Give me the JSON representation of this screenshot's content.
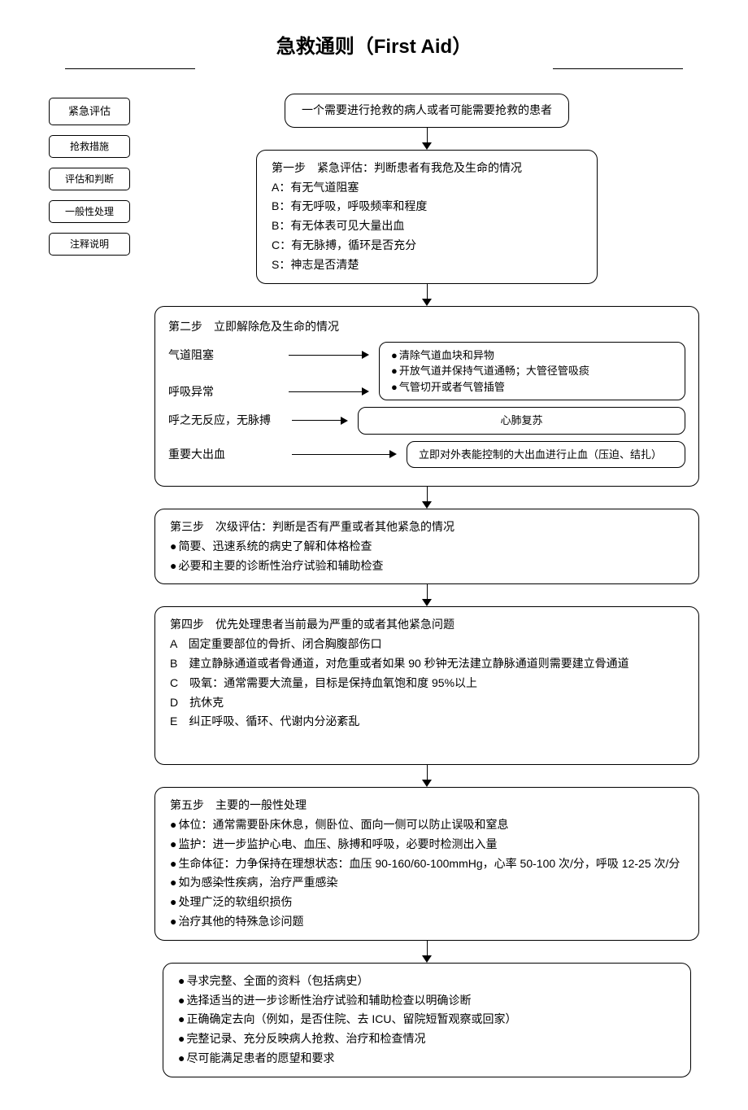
{
  "title": "急救通则（First Aid）",
  "sidebar": {
    "items": [
      {
        "label": "紧急评估"
      },
      {
        "label": "抢救措施"
      },
      {
        "label": "评估和判断"
      },
      {
        "label": "一般性处理"
      },
      {
        "label": "注释说明"
      }
    ]
  },
  "start": "一个需要进行抢救的病人或者可能需要抢救的患者",
  "step1": {
    "title": "第一步　紧急评估：判断患者有我危及生命的情况",
    "lines": [
      "A：有无气道阻塞",
      "B：有无呼吸，呼吸频率和程度",
      "B：有无体表可见大量出血",
      "C：有无脉搏，循环是否充分",
      "S：神志是否清楚"
    ]
  },
  "step2": {
    "title": "第二步　立即解除危及生命的情况",
    "rows": [
      {
        "left": "气道阻塞",
        "right": [
          "清除气道血块和异物",
          "开放气道并保持气道通畅；大管径管吸痰",
          "气管切开或者气管插管"
        ],
        "type": "bullets"
      },
      {
        "left": "呼吸异常",
        "merge_above": true
      },
      {
        "left": "呼之无反应，无脉搏",
        "right_text": "心肺复苏",
        "type": "center"
      },
      {
        "left": "重要大出血",
        "right_text": "立即对外表能控制的大出血进行止血（压迫、结扎）",
        "type": "plain"
      }
    ]
  },
  "step3": {
    "title": "第三步　次级评估：判断是否有严重或者其他紧急的情况",
    "bullets": [
      "简要、迅速系统的病史了解和体格检查",
      "必要和主要的诊断性治疗试验和辅助检查"
    ]
  },
  "step4": {
    "title": "第四步　优先处理患者当前最为严重的或者其他紧急问题",
    "letters": [
      "A　固定重要部位的骨折、闭合胸腹部伤口",
      "B　建立静脉通道或者骨通道，对危重或者如果 90 秒钟无法建立静脉通道则需要建立骨通道",
      "C　吸氧：通常需要大流量，目标是保持血氧饱和度 95%以上",
      "D　抗休克",
      "E　纠正呼吸、循环、代谢内分泌紊乱"
    ]
  },
  "step5": {
    "title": "第五步　主要的一般性处理",
    "bullets": [
      "体位：通常需要卧床休息，侧卧位、面向一侧可以防止误吸和窒息",
      "监护：进一步监护心电、血压、脉搏和呼吸，必要时检测出入量",
      "生命体征：力争保持在理想状态：血压 90-160/60-100mmHg，心率 50-100 次/分，呼吸 12-25 次/分",
      "如为感染性疾病，治疗严重感染",
      "处理广泛的软组织损伤",
      "治疗其他的特殊急诊问题"
    ]
  },
  "step6": {
    "bullets": [
      "寻求完整、全面的资料（包括病史）",
      "选择适当的进一步诊断性治疗试验和辅助检查以明确诊断",
      "正确确定去向（例如，是否住院、去 ICU、留院短暂观察或回家）",
      "完整记录、充分反映病人抢救、治疗和检查情况",
      "尽可能满足患者的愿望和要求"
    ]
  }
}
